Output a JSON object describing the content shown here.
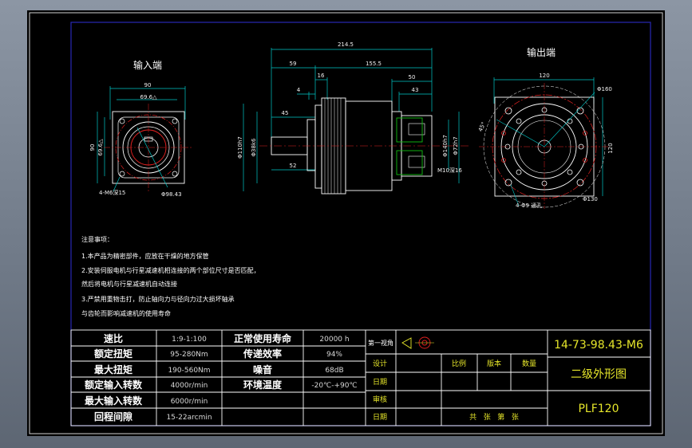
{
  "labels": {
    "input_end": "输入端",
    "output_end": "输出端"
  },
  "dimensions": {
    "front_input": {
      "width": "90",
      "chord": "69.6△",
      "height": "90",
      "height2": "69.6△",
      "holes": "4-M6深15",
      "pcd": "Φ98.43"
    },
    "side": {
      "total": "214.5",
      "left": "59",
      "body": "155.5",
      "flange": "16",
      "shaft": "4",
      "len45": "45",
      "len52": "52",
      "right50": "50",
      "right43": "43",
      "dia110": "Φ110h7",
      "dia38": "Φ38k6",
      "dia140": "Φ140h7",
      "dia72": "Φ72h7",
      "m10": "M10深16"
    },
    "front_output": {
      "width": "120",
      "angle": "45°",
      "dia160": "Φ160",
      "height": "120",
      "holes": "4-Φ9 通孔",
      "dia130": "Φ130"
    }
  },
  "notes": [
    "注意事项：",
    "1.本产品为精密部件，应放在干燥的地方保管",
    "2.安装伺服电机与行星减速机相连接的两个部位尺寸是否匹配，",
    "然后将电机与行星减速机自动连接",
    "3.严禁用重物击打，防止轴向力与径向力过大损坏轴承",
    "与齿轮而影响减速机的使用寿命"
  ],
  "specs": [
    {
      "label": "速比",
      "value": "1:9-1:100",
      "label2": "正常使用寿命",
      "value2": "20000 h"
    },
    {
      "label": "额定扭矩",
      "value": "95-280Nm",
      "label2": "传递效率",
      "value2": "94%"
    },
    {
      "label": "最大扭矩",
      "value": "190-560Nm",
      "label2": "噪音",
      "value2": "68dB"
    },
    {
      "label": "额定输入转数",
      "value": "4000r/min",
      "label2": "环境温度",
      "value2": "-20℃-+90℃"
    },
    {
      "label": "最大输入转数",
      "value": "6000r/min",
      "label2": "",
      "value2": ""
    },
    {
      "label": "回程间隙",
      "value": "15-22arcmin",
      "label2": "",
      "value2": ""
    }
  ],
  "titleblock": {
    "projection": "第一视角",
    "design": "设计",
    "date1": "日期",
    "review": "审核",
    "date2": "日期",
    "scale": "比例",
    "version": "版本",
    "quantity": "数量",
    "sheets": "共   张   第   张",
    "code": "14-73-98.43-M6",
    "name": "二级外形图",
    "model": "PLF120"
  },
  "colors": {
    "cyan": "#00c8c8",
    "red": "#e02020",
    "yellow": "#e6e62a",
    "green": "#10c010",
    "white": "#ffffff",
    "frame_blue": "#2828b4"
  }
}
